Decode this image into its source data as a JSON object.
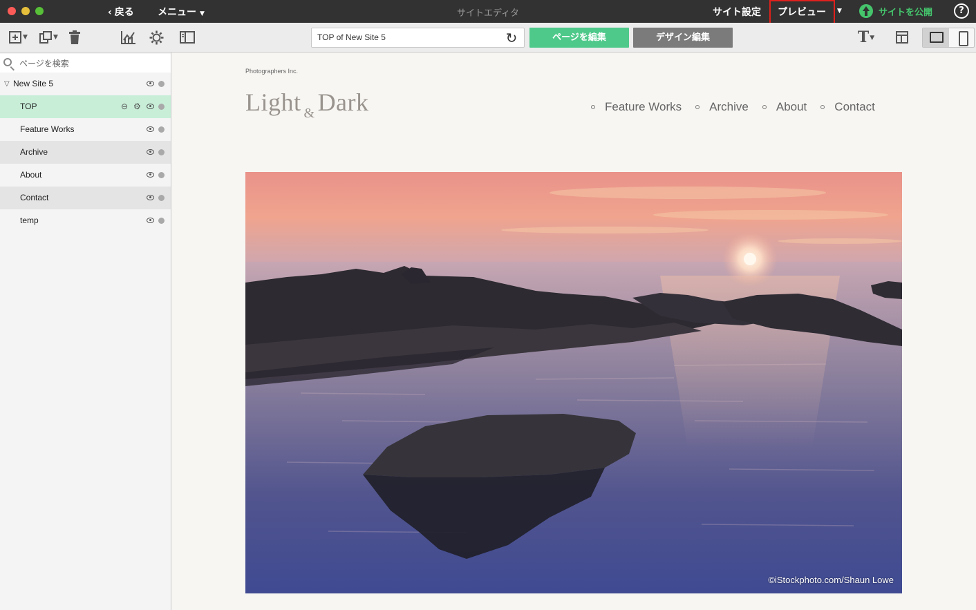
{
  "titlebar": {
    "back_label": "戻る",
    "menu_label": "メニュー",
    "app_title": "サイトエディタ",
    "site_settings_label": "サイト設定",
    "preview_label": "プレビュー",
    "publish_label": "サイトを公開",
    "help_label": "?"
  },
  "toolbar": {
    "page_title_value": "TOP of New Site 5",
    "edit_page_label": "ページを編集",
    "edit_design_label": "デザイン編集",
    "text_tool_label": "T"
  },
  "sidebar": {
    "search_placeholder": "ページを検索",
    "root_label": "New Site 5",
    "pages": [
      {
        "label": "TOP"
      },
      {
        "label": "Feature Works"
      },
      {
        "label": "Archive"
      },
      {
        "label": "About"
      },
      {
        "label": "Contact"
      },
      {
        "label": "temp"
      }
    ]
  },
  "site": {
    "company": "Photographers Inc.",
    "logo_left": "Light",
    "logo_amp": "&",
    "logo_right": "Dark",
    "nav": [
      {
        "label": "Feature Works"
      },
      {
        "label": "Archive"
      },
      {
        "label": "About"
      },
      {
        "label": "Contact"
      }
    ],
    "hero_credit": "©iStockphoto.com/Shaun Lowe"
  },
  "colors": {
    "titlebar_bg": "#323232",
    "accent_green": "#4ec98a",
    "publish_green": "#45c46c",
    "selected_row": "#c8eed8",
    "highlight_red": "#e0201c"
  }
}
